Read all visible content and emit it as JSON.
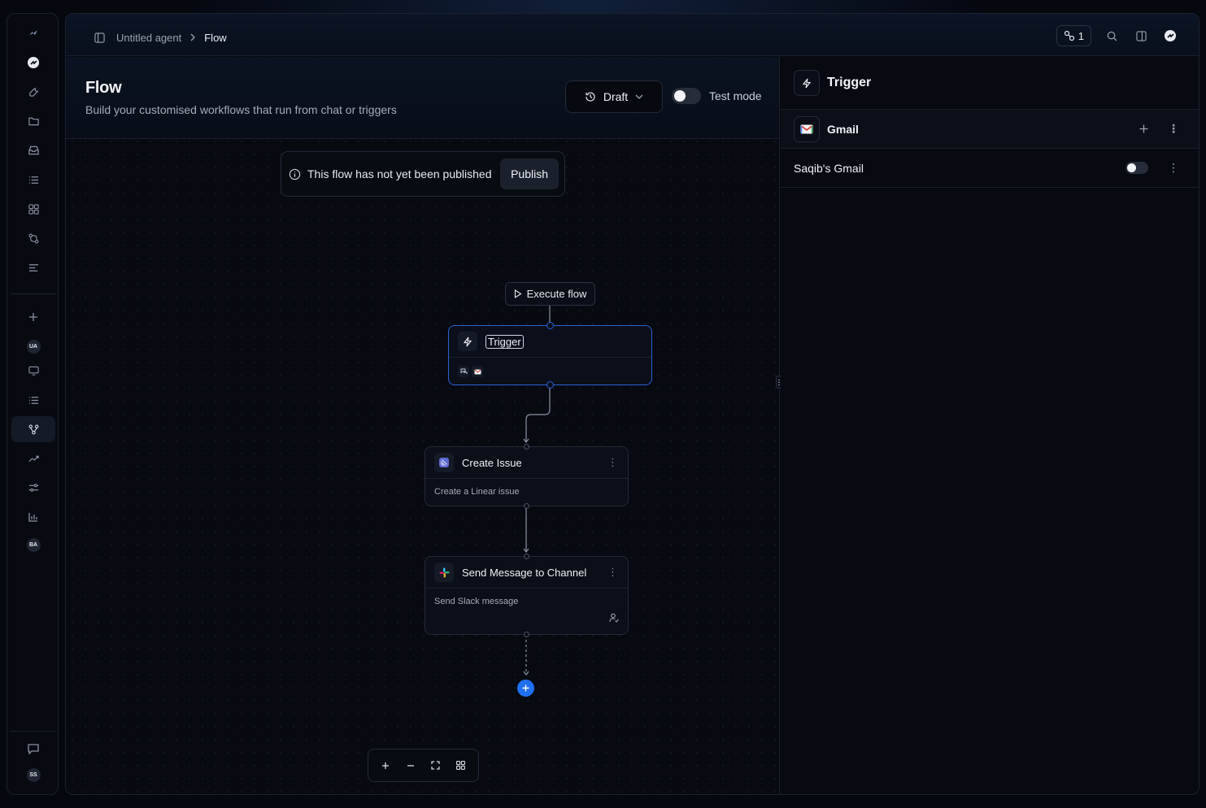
{
  "breadcrumb": {
    "parent": "Untitled agent",
    "current": "Flow"
  },
  "topbar": {
    "connections_count": "1"
  },
  "page": {
    "title": "Flow",
    "subtitle": "Build your customised workflows that run from chat or triggers",
    "version_label": "Draft",
    "test_mode_label": "Test mode",
    "test_mode_on": false
  },
  "banner": {
    "message": "This flow has not yet been published",
    "publish_label": "Publish"
  },
  "canvas": {
    "execute_label": "Execute flow",
    "trigger_node": {
      "title": "Trigger"
    },
    "nodes": [
      {
        "title": "Create Issue",
        "description": "Create a Linear issue",
        "icon": "linear-icon"
      },
      {
        "title": "Send Message to Channel",
        "description": "Send Slack message",
        "icon": "slack-icon"
      }
    ]
  },
  "right_panel": {
    "title": "Trigger",
    "app_name": "Gmail",
    "account_name": "Saqib's Gmail",
    "account_enabled": false
  },
  "rail": {
    "workspace_badge": "UA",
    "second_badge": "BA",
    "user_badge": "SS"
  },
  "colors": {
    "accent": "#1f6ff2",
    "selected_border": "#2a62d6",
    "background": "#05080f"
  }
}
